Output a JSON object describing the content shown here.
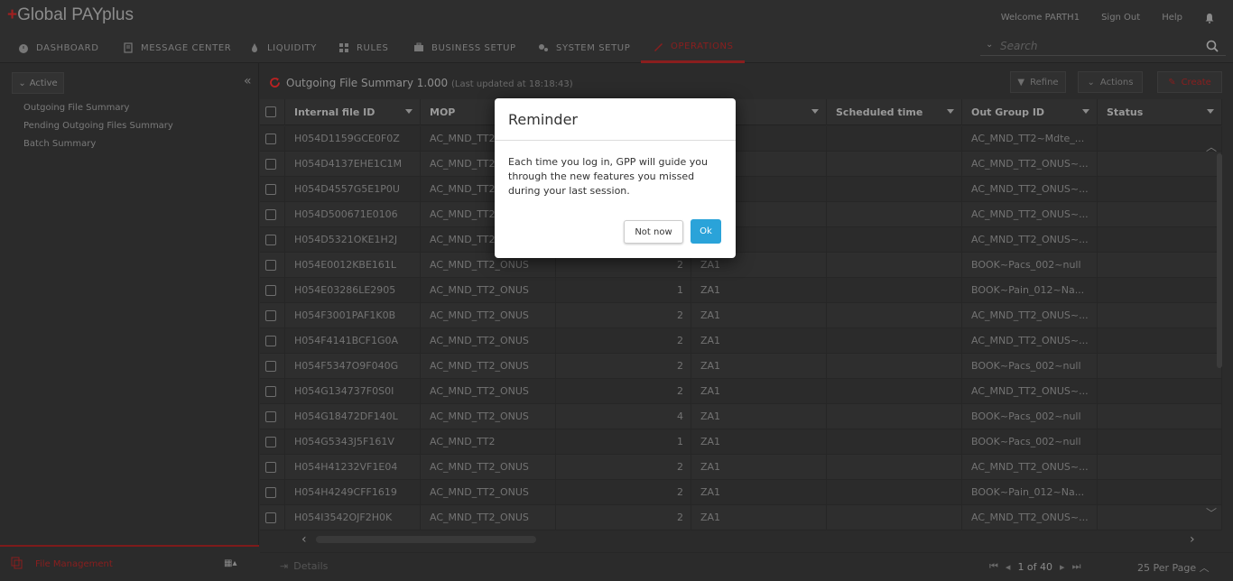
{
  "app": {
    "logo_plus": "+",
    "logo_text": "Global PAYplus"
  },
  "toplinks": {
    "welcome": "Welcome PARTH1",
    "signout": "Sign Out",
    "help": "Help"
  },
  "nav": {
    "items": [
      {
        "label": "DASHBOARD",
        "icon": "dashboard-icon"
      },
      {
        "label": "MESSAGE CENTER",
        "icon": "document-icon"
      },
      {
        "label": "LIQUIDITY",
        "icon": "droplet-icon"
      },
      {
        "label": "RULES",
        "icon": "grid-icon"
      },
      {
        "label": "BUSINESS SETUP",
        "icon": "briefcase-icon"
      },
      {
        "label": "SYSTEM SETUP",
        "icon": "gears-icon"
      },
      {
        "label": "OPERATIONS",
        "icon": "wrench-icon"
      }
    ],
    "active": "OPERATIONS",
    "accent": "#8a1e1e"
  },
  "search": {
    "placeholder": "Search"
  },
  "sidebar": {
    "active_label": "Active",
    "links": [
      "Outgoing File Summary",
      "Pending Outgoing Files Summary",
      "Batch Summary"
    ],
    "bottom_label": "File Management"
  },
  "header": {
    "title": "Outgoing File Summary 1.000",
    "updated": "(Last updated at 18:18:43)",
    "refine": "Refine",
    "actions": "Actions",
    "create": "Create"
  },
  "table": {
    "columns": [
      "Internal file ID",
      "MOP",
      "",
      "",
      "Scheduled time",
      "Out Group ID",
      "Status"
    ],
    "rows": [
      [
        "H054D1159GCE0F0Z",
        "AC_MND_TT2",
        "",
        "",
        "",
        "AC_MND_TT2~Mdte_...",
        ""
      ],
      [
        "H054D4137EHE1C1M",
        "AC_MND_TT2",
        "",
        "",
        "",
        "AC_MND_TT2_ONUS~...",
        ""
      ],
      [
        "H054D4557G5E1P0U",
        "AC_MND_TT2",
        "",
        "",
        "",
        "AC_MND_TT2_ONUS~...",
        ""
      ],
      [
        "H054D500671E0106",
        "AC_MND_TT2",
        "",
        "",
        "",
        "AC_MND_TT2_ONUS~...",
        ""
      ],
      [
        "H054D5321OKE1H2J",
        "AC_MND_TT2",
        "",
        "",
        "",
        "AC_MND_TT2_ONUS~...",
        ""
      ],
      [
        "H054E0012KBE161L",
        "AC_MND_TT2_ONUS",
        "2",
        "ZA1",
        "",
        "BOOK~Pacs_002~null",
        ""
      ],
      [
        "H054E03286LE2905",
        "AC_MND_TT2_ONUS",
        "1",
        "ZA1",
        "",
        "BOOK~Pain_012~Na...",
        ""
      ],
      [
        "H054F3001PAF1K0B",
        "AC_MND_TT2_ONUS",
        "2",
        "ZA1",
        "",
        "AC_MND_TT2_ONUS~...",
        ""
      ],
      [
        "H054F4141BCF1G0A",
        "AC_MND_TT2_ONUS",
        "2",
        "ZA1",
        "",
        "AC_MND_TT2_ONUS~...",
        ""
      ],
      [
        "H054F5347O9F040G",
        "AC_MND_TT2_ONUS",
        "2",
        "ZA1",
        "",
        "BOOK~Pacs_002~null",
        ""
      ],
      [
        "H054G134737F0S0I",
        "AC_MND_TT2_ONUS",
        "2",
        "ZA1",
        "",
        "AC_MND_TT2_ONUS~...",
        ""
      ],
      [
        "H054G18472DF140L",
        "AC_MND_TT2_ONUS",
        "4",
        "ZA1",
        "",
        "BOOK~Pacs_002~null",
        ""
      ],
      [
        "H054G5343J5F161V",
        "AC_MND_TT2",
        "1",
        "ZA1",
        "",
        "BOOK~Pacs_002~null",
        ""
      ],
      [
        "H054H41232VF1E04",
        "AC_MND_TT2_ONUS",
        "2",
        "ZA1",
        "",
        "AC_MND_TT2_ONUS~...",
        ""
      ],
      [
        "H054H4249CFF1619",
        "AC_MND_TT2_ONUS",
        "2",
        "ZA1",
        "",
        "BOOK~Pain_012~Na...",
        ""
      ],
      [
        "H054I3542OJF2H0K",
        "AC_MND_TT2_ONUS",
        "2",
        "ZA1",
        "",
        "AC_MND_TT2_ONUS~...",
        ""
      ]
    ]
  },
  "footer": {
    "details": "Details",
    "page": "1 of 40",
    "per_page": "25 Per Page"
  },
  "modal": {
    "title": "Reminder",
    "body": "Each time you log in, GPP will guide you through the new features you missed during your last session.",
    "not_now": "Not now",
    "ok": "Ok",
    "ok_color": "#2aa3d9"
  }
}
